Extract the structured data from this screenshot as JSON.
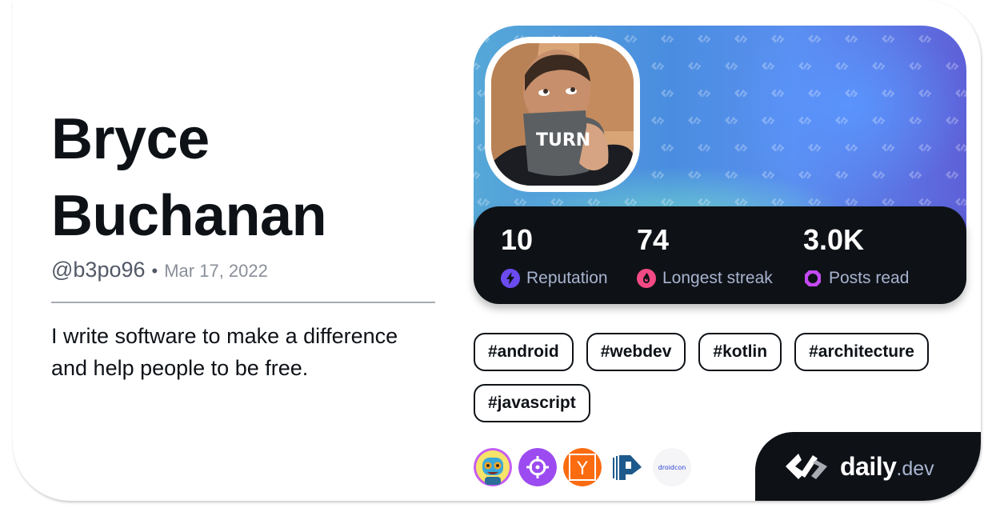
{
  "profile": {
    "name_line1": "Bryce",
    "name_line2": "Buchanan",
    "username": "@b3po96",
    "separator": "•",
    "joined_date": "Mar 17, 2022",
    "bio": "I write software to make a difference and help people to be free."
  },
  "avatar": {
    "icon": "user-photo-avatar",
    "mug_text": "TURN"
  },
  "stats": [
    {
      "value": "10",
      "label": "Reputation",
      "icon": "reputation-bolt-icon",
      "color": "#6b4bf0"
    },
    {
      "value": "74",
      "label": "Longest streak",
      "icon": "streak-flame-icon",
      "color": "#f34a84"
    },
    {
      "value": "3.0K",
      "label": "Posts read",
      "icon": "posts-read-ring-icon",
      "color": "#c34af2"
    }
  ],
  "tags": [
    "#android",
    "#webdev",
    "#kotlin",
    "#architecture",
    "#javascript"
  ],
  "squads": [
    {
      "name": "robot-squad",
      "icon": "robot-icon"
    },
    {
      "name": "target-squad",
      "icon": "crosshair-icon"
    },
    {
      "name": "hacker-news",
      "icon": "y-combinator-icon",
      "letter": "Y"
    },
    {
      "name": "p-squad",
      "icon": "p-logo-icon"
    },
    {
      "name": "droidcon",
      "icon": "droidcon-logo",
      "text": "droidcon"
    }
  ],
  "brand": {
    "word": "daily",
    "tld": ".dev"
  },
  "colors": {
    "ink": "#0e1217",
    "muted": "#525866",
    "stat_label": "#a8b3cf"
  }
}
